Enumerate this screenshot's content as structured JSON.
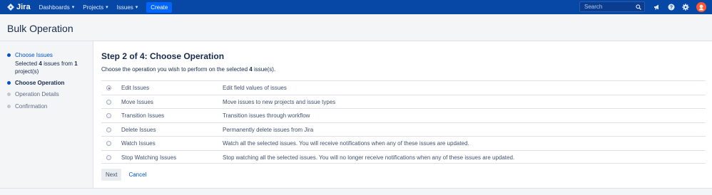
{
  "nav": {
    "brand": "Jira",
    "items": [
      {
        "label": "Dashboards"
      },
      {
        "label": "Projects"
      },
      {
        "label": "Issues"
      }
    ],
    "create_label": "Create",
    "search_placeholder": "Search",
    "icons": [
      "megaphone-icon",
      "help-icon",
      "settings-icon",
      "avatar"
    ],
    "colors": {
      "bar": "#0747a6",
      "create": "#0065ff"
    }
  },
  "page": {
    "title": "Bulk Operation"
  },
  "wizard": {
    "steps": [
      {
        "label": "Choose Issues",
        "state": "done"
      },
      {
        "label": "Choose Operation",
        "state": "current"
      },
      {
        "label": "Operation Details",
        "state": "todo"
      },
      {
        "label": "Confirmation",
        "state": "todo"
      }
    ],
    "selection": {
      "prefix": "Selected",
      "count": "4",
      "middle": "issues from",
      "projects": "1",
      "suffix": "project(s)"
    }
  },
  "main": {
    "title": "Step 2 of 4: Choose Operation",
    "desc_prefix": "Choose the operation you wish to perform on the selected",
    "desc_count": "4",
    "desc_suffix": "issue(s).",
    "operations": [
      {
        "name": "Edit Issues",
        "desc": "Edit field values of issues",
        "checked": true
      },
      {
        "name": "Move Issues",
        "desc": "Move issues to new projects and issue types",
        "checked": false
      },
      {
        "name": "Transition Issues",
        "desc": "Transition issues through workflow",
        "checked": false
      },
      {
        "name": "Delete Issues",
        "desc": "Permanently delete issues from Jira",
        "checked": false
      },
      {
        "name": "Watch Issues",
        "desc": "Watch all the selected issues. You will receive notifications when any of these issues are updated.",
        "checked": false
      },
      {
        "name": "Stop Watching Issues",
        "desc": "Stop watching all the selected issues. You will no longer receive notifications when any of these issues are updated.",
        "checked": false
      }
    ],
    "next_label": "Next",
    "cancel_label": "Cancel"
  }
}
